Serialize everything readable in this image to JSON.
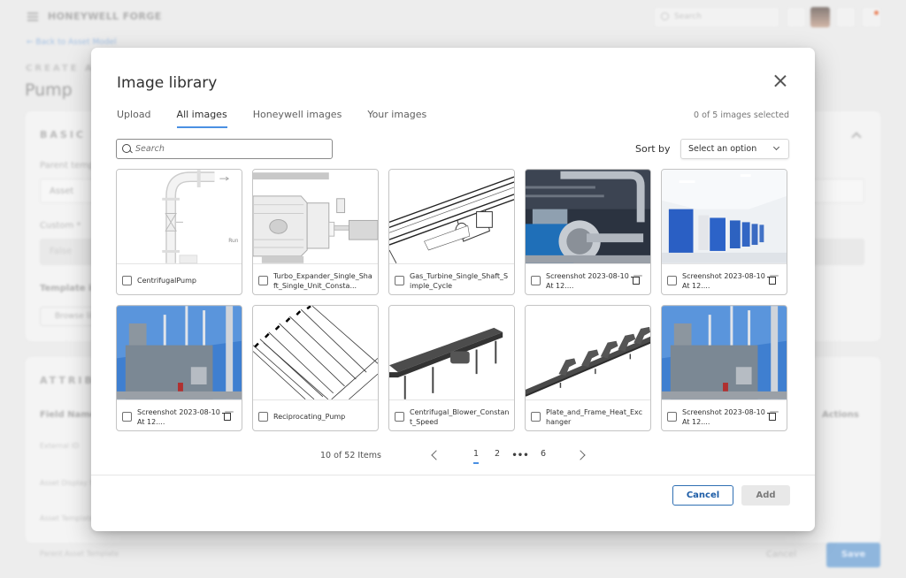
{
  "app": {
    "brand": "HONEYWELL FORGE",
    "search_placeholder": "Search",
    "back_link": "Back to Asset Model",
    "create_label": "CREATE ASSET TEMPLATE",
    "page_title": "Pump",
    "basic_info": {
      "title": "BASIC INFORMATION",
      "parent_template_label": "Parent template",
      "parent_template_value": "Asset",
      "custom_label": "Custom *",
      "custom_value": "False",
      "template_image_label": "Template image",
      "browse_button": "Browse library"
    },
    "attributes": {
      "title": "ATTRIBUTES",
      "col_field_name": "Field Name",
      "col_actions": "Actions",
      "rows": [
        "External ID",
        "Asset Display Name",
        "Asset Template",
        "Parent Asset Template"
      ]
    },
    "footer": {
      "cancel": "Cancel",
      "save": "Save"
    }
  },
  "modal": {
    "title": "Image library",
    "tabs": [
      {
        "label": "Upload",
        "active": false
      },
      {
        "label": "All images",
        "active": true
      },
      {
        "label": "Honeywell images",
        "active": false
      },
      {
        "label": "Your images",
        "active": false
      }
    ],
    "selection_status": "0 of 5 images selected",
    "search": {
      "placeholder": "Search",
      "value": ""
    },
    "sort": {
      "label": "Sort by",
      "selected": "Select an option"
    },
    "images": [
      {
        "name": "CentrifugalPump",
        "kind": "drawing",
        "deletable": false,
        "checked": false
      },
      {
        "name": "Turbo_Expander_Single_Shaft_Single_Unit_Consta...",
        "kind": "drawing",
        "deletable": false,
        "checked": false
      },
      {
        "name": "Gas_Turbine_Single_Shaft_Simple_Cycle",
        "kind": "drawing",
        "deletable": false,
        "checked": false
      },
      {
        "name": "Screenshot 2023-08-10 At 12....",
        "kind": "photo",
        "deletable": true,
        "checked": false
      },
      {
        "name": "Screenshot 2023-08-10 At 12....",
        "kind": "photo",
        "deletable": true,
        "checked": false
      },
      {
        "name": "Screenshot 2023-08-10 At 12....",
        "kind": "photo",
        "deletable": true,
        "checked": false
      },
      {
        "name": "Reciprocating_Pump",
        "kind": "drawing",
        "deletable": false,
        "checked": false
      },
      {
        "name": "Centrifugal_Blower_Constant_Speed",
        "kind": "render",
        "deletable": false,
        "checked": false
      },
      {
        "name": "Plate_and_Frame_Heat_Exchanger",
        "kind": "render",
        "deletable": false,
        "checked": false
      },
      {
        "name": "Screenshot 2023-08-10 At 12....",
        "kind": "photo",
        "deletable": true,
        "checked": false
      }
    ],
    "pagination": {
      "summary": "10 of 52 Items",
      "pages": [
        "1",
        "2",
        "6"
      ],
      "ellipsis": "•••",
      "current_page": "1"
    },
    "buttons": {
      "cancel": "Cancel",
      "add": "Add"
    },
    "colors": {
      "accent": "#4a90e2",
      "primary_border": "#2f6fb3"
    }
  }
}
